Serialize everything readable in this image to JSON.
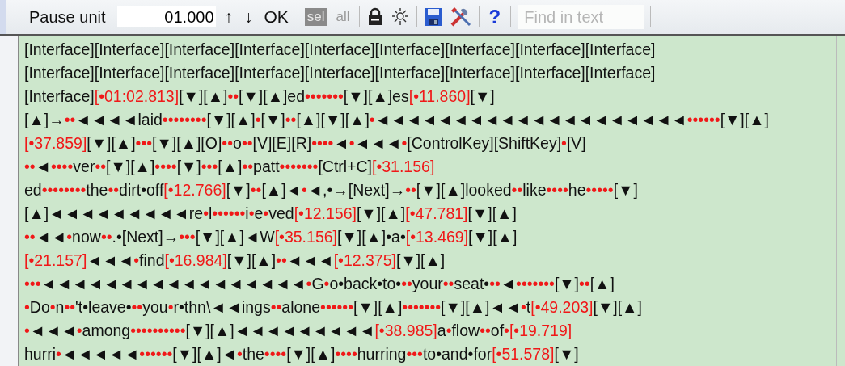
{
  "toolbar": {
    "pause_label": "Pause unit",
    "pause_value": "01.000",
    "up": "↑",
    "down": "↓",
    "ok": "OK",
    "selection": [
      {
        "label": "sel",
        "selected": true
      },
      {
        "label": "all",
        "selected": false
      }
    ],
    "help": "?",
    "search": {
      "placeholder": "Find in text"
    }
  },
  "lines": [
    [
      {
        "kind": "text",
        "text": "[Interface][Interface][Interface][Interface][Interface][Interface][Interface][Interface][Interface]"
      }
    ],
    [
      {
        "kind": "text",
        "text": "[Interface][Interface][Interface][Interface][Interface][Interface][Interface][Interface][Interface]"
      }
    ],
    [
      {
        "kind": "text",
        "text": "[Interface]"
      },
      {
        "kind": "time",
        "text": "[•01:02.813]"
      },
      {
        "kind": "text",
        "text": "[▼][▲]"
      },
      {
        "kind": "mark",
        "text": "••"
      },
      {
        "kind": "text",
        "text": "[▼][▲]ed"
      },
      {
        "kind": "mark",
        "text": "•••••••"
      },
      {
        "kind": "text",
        "text": "[▼][▲]es"
      },
      {
        "kind": "time",
        "text": "[•11.860]"
      },
      {
        "kind": "text",
        "text": "[▼]"
      }
    ],
    [
      {
        "kind": "text",
        "text": "[▲]→"
      },
      {
        "kind": "mark",
        "text": "••"
      },
      {
        "kind": "text",
        "text": "◄◄◄◄laid"
      },
      {
        "kind": "mark",
        "text": "••••••••"
      },
      {
        "kind": "text",
        "text": "[▼][▲]"
      },
      {
        "kind": "mark",
        "text": "•"
      },
      {
        "kind": "text",
        "text": "[▼]"
      },
      {
        "kind": "mark",
        "text": "••"
      },
      {
        "kind": "text",
        "text": "[▲][▼][▲]"
      },
      {
        "kind": "mark",
        "text": "•"
      },
      {
        "kind": "text",
        "text": "◄◄◄◄◄◄◄◄◄◄◄◄◄◄◄◄◄◄◄◄"
      },
      {
        "kind": "mark",
        "text": "••••••"
      },
      {
        "kind": "text",
        "text": "[▼][▲]"
      }
    ],
    [
      {
        "kind": "time",
        "text": "[•37.859]"
      },
      {
        "kind": "text",
        "text": "[▼][▲]"
      },
      {
        "kind": "mark",
        "text": "•••"
      },
      {
        "kind": "text",
        "text": "[▼][▲][O]"
      },
      {
        "kind": "mark",
        "text": "••"
      },
      {
        "kind": "text",
        "text": "o"
      },
      {
        "kind": "mark",
        "text": "••"
      },
      {
        "kind": "text",
        "text": "[V][E][R]"
      },
      {
        "kind": "mark",
        "text": "••••"
      },
      {
        "kind": "text",
        "text": "◄"
      },
      {
        "kind": "mark",
        "text": "•"
      },
      {
        "kind": "text",
        "text": "◄◄◄"
      },
      {
        "kind": "mark",
        "text": "•"
      },
      {
        "kind": "text",
        "text": "[ControlKey][ShiftKey]"
      },
      {
        "kind": "mark",
        "text": "•"
      },
      {
        "kind": "text",
        "text": "[V]"
      }
    ],
    [
      {
        "kind": "mark",
        "text": "••"
      },
      {
        "kind": "text",
        "text": "◄"
      },
      {
        "kind": "mark",
        "text": "••••"
      },
      {
        "kind": "text",
        "text": "ver"
      },
      {
        "kind": "mark",
        "text": "••"
      },
      {
        "kind": "text",
        "text": "[▼][▲]"
      },
      {
        "kind": "mark",
        "text": "••••"
      },
      {
        "kind": "text",
        "text": "[▼]"
      },
      {
        "kind": "mark",
        "text": "•••"
      },
      {
        "kind": "text",
        "text": "[▲]"
      },
      {
        "kind": "mark",
        "text": "••"
      },
      {
        "kind": "text",
        "text": "patt"
      },
      {
        "kind": "mark",
        "text": "•••••••"
      },
      {
        "kind": "text",
        "text": "[Ctrl+C]"
      },
      {
        "kind": "time",
        "text": "[•31.156]"
      }
    ],
    [
      {
        "kind": "text",
        "text": "ed"
      },
      {
        "kind": "mark",
        "text": "••••••••"
      },
      {
        "kind": "text",
        "text": "the"
      },
      {
        "kind": "mark",
        "text": "••"
      },
      {
        "kind": "text",
        "text": "dirt•off"
      },
      {
        "kind": "time",
        "text": "[•12.766]"
      },
      {
        "kind": "text",
        "text": "[▼]"
      },
      {
        "kind": "mark",
        "text": "••"
      },
      {
        "kind": "text",
        "text": "[▲]◄"
      },
      {
        "kind": "mark",
        "text": "•"
      },
      {
        "kind": "text",
        "text": "◄,•→[Next]→"
      },
      {
        "kind": "mark",
        "text": "••"
      },
      {
        "kind": "text",
        "text": "[▼][▲]looked"
      },
      {
        "kind": "mark",
        "text": "••"
      },
      {
        "kind": "text",
        "text": "like"
      },
      {
        "kind": "mark",
        "text": "••••"
      },
      {
        "kind": "text",
        "text": "he"
      },
      {
        "kind": "mark",
        "text": "•••••"
      },
      {
        "kind": "text",
        "text": "[▼]"
      }
    ],
    [
      {
        "kind": "text",
        "text": "[▲]◄◄◄◄◄◄◄◄◄re"
      },
      {
        "kind": "mark",
        "text": "•"
      },
      {
        "kind": "text",
        "text": "l"
      },
      {
        "kind": "mark",
        "text": "••••••"
      },
      {
        "kind": "text",
        "text": "i"
      },
      {
        "kind": "mark",
        "text": "•"
      },
      {
        "kind": "text",
        "text": "e"
      },
      {
        "kind": "mark",
        "text": "•"
      },
      {
        "kind": "text",
        "text": "ved"
      },
      {
        "kind": "time",
        "text": "[•12.156]"
      },
      {
        "kind": "text",
        "text": "[▼][▲]"
      },
      {
        "kind": "time",
        "text": "[•47.781]"
      },
      {
        "kind": "text",
        "text": "[▼][▲]"
      }
    ],
    [
      {
        "kind": "mark",
        "text": "••"
      },
      {
        "kind": "text",
        "text": "◄◄"
      },
      {
        "kind": "mark",
        "text": "•"
      },
      {
        "kind": "text",
        "text": "now"
      },
      {
        "kind": "mark",
        "text": "••"
      },
      {
        "kind": "text",
        "text": ".•[Next]→"
      },
      {
        "kind": "mark",
        "text": "•••"
      },
      {
        "kind": "text",
        "text": "[▼][▲]◄W"
      },
      {
        "kind": "time",
        "text": "[•35.156]"
      },
      {
        "kind": "text",
        "text": "[▼][▲]•a•"
      },
      {
        "kind": "time",
        "text": "[•13.469]"
      },
      {
        "kind": "text",
        "text": "[▼][▲]"
      }
    ],
    [
      {
        "kind": "time",
        "text": "[•21.157]"
      },
      {
        "kind": "text",
        "text": "◄◄◄"
      },
      {
        "kind": "mark",
        "text": "•"
      },
      {
        "kind": "text",
        "text": "find"
      },
      {
        "kind": "time",
        "text": "[•16.984]"
      },
      {
        "kind": "text",
        "text": "[▼][▲]"
      },
      {
        "kind": "mark",
        "text": "••"
      },
      {
        "kind": "text",
        "text": "◄◄◄"
      },
      {
        "kind": "time",
        "text": "[•12.375]"
      },
      {
        "kind": "text",
        "text": "[▼][▲]"
      }
    ],
    [
      {
        "kind": "mark",
        "text": "•••"
      },
      {
        "kind": "text",
        "text": "◄◄◄◄◄◄◄◄◄◄◄◄◄◄◄◄◄"
      },
      {
        "kind": "mark",
        "text": "•"
      },
      {
        "kind": "text",
        "text": "G"
      },
      {
        "kind": "mark",
        "text": "•"
      },
      {
        "kind": "text",
        "text": "o•back•to•"
      },
      {
        "kind": "mark",
        "text": "••"
      },
      {
        "kind": "text",
        "text": "your"
      },
      {
        "kind": "mark",
        "text": "••"
      },
      {
        "kind": "text",
        "text": "seat•"
      },
      {
        "kind": "mark",
        "text": "••"
      },
      {
        "kind": "text",
        "text": "◄"
      },
      {
        "kind": "mark",
        "text": "•••••••"
      },
      {
        "kind": "text",
        "text": "[▼]"
      },
      {
        "kind": "mark",
        "text": "••"
      },
      {
        "kind": "text",
        "text": "[▲]"
      }
    ],
    [
      {
        "kind": "mark",
        "text": "•"
      },
      {
        "kind": "text",
        "text": "Do"
      },
      {
        "kind": "mark",
        "text": "•"
      },
      {
        "kind": "text",
        "text": "n"
      },
      {
        "kind": "mark",
        "text": "••"
      },
      {
        "kind": "text",
        "text": "'t•leave•"
      },
      {
        "kind": "mark",
        "text": "••"
      },
      {
        "kind": "text",
        "text": "you"
      },
      {
        "kind": "mark",
        "text": "•"
      },
      {
        "kind": "text",
        "text": "r•thn\\◄◄ings"
      },
      {
        "kind": "mark",
        "text": "••"
      },
      {
        "kind": "text",
        "text": "alone"
      },
      {
        "kind": "mark",
        "text": "••••••"
      },
      {
        "kind": "text",
        "text": "[▼][▲]"
      },
      {
        "kind": "mark",
        "text": "•••••••"
      },
      {
        "kind": "text",
        "text": "[▼][▲]◄◄"
      },
      {
        "kind": "mark",
        "text": "•"
      },
      {
        "kind": "text",
        "text": "t"
      },
      {
        "kind": "time",
        "text": "[•49.203]"
      },
      {
        "kind": "text",
        "text": "[▼][▲]"
      }
    ],
    [
      {
        "kind": "mark",
        "text": "•"
      },
      {
        "kind": "text",
        "text": "◄◄◄"
      },
      {
        "kind": "mark",
        "text": "•"
      },
      {
        "kind": "text",
        "text": "among"
      },
      {
        "kind": "mark",
        "text": "••••••••••"
      },
      {
        "kind": "text",
        "text": "[▼][▲]◄◄◄◄◄◄◄◄◄"
      },
      {
        "kind": "time",
        "text": "[•38.985]"
      },
      {
        "kind": "text",
        "text": "a"
      },
      {
        "kind": "mark",
        "text": "•"
      },
      {
        "kind": "text",
        "text": "flow"
      },
      {
        "kind": "mark",
        "text": "••"
      },
      {
        "kind": "text",
        "text": "of"
      },
      {
        "kind": "mark",
        "text": "•"
      },
      {
        "kind": "time",
        "text": "[•19.719]"
      }
    ],
    [
      {
        "kind": "text",
        "text": "hurri"
      },
      {
        "kind": "mark",
        "text": "•"
      },
      {
        "kind": "text",
        "text": "◄◄◄◄◄"
      },
      {
        "kind": "mark",
        "text": "••••••"
      },
      {
        "kind": "text",
        "text": "[▼][▲]◄"
      },
      {
        "kind": "mark",
        "text": "•"
      },
      {
        "kind": "text",
        "text": "the"
      },
      {
        "kind": "mark",
        "text": "••••"
      },
      {
        "kind": "text",
        "text": "[▼][▲]"
      },
      {
        "kind": "mark",
        "text": "••••"
      },
      {
        "kind": "text",
        "text": "hurring"
      },
      {
        "kind": "mark",
        "text": "•••"
      },
      {
        "kind": "text",
        "text": "to•and•for"
      },
      {
        "kind": "time",
        "text": "[•51.578]"
      },
      {
        "kind": "text",
        "text": "[▼]"
      }
    ]
  ]
}
